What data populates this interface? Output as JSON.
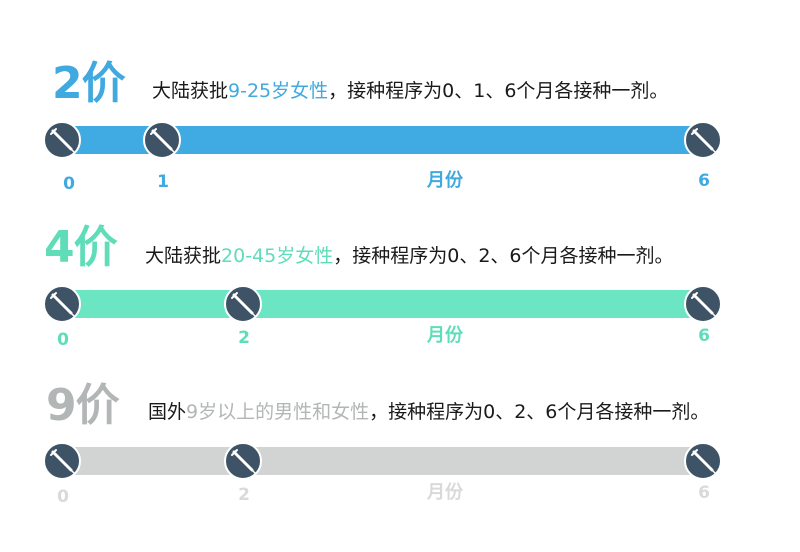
{
  "rows": [
    {
      "valence": "2价",
      "desc_prefix": "大陆获批",
      "desc_highlight": "9-25岁女性",
      "desc_suffix": "，接种程序为0、1、6个月各接种一剂。",
      "color": "#3fa9e0",
      "bar_color": "#40abe2",
      "ticks": [
        "0",
        "1",
        "6"
      ],
      "axis_label": "月份"
    },
    {
      "valence": "4价",
      "desc_prefix": "大陆获批",
      "desc_highlight": "20-45岁女性",
      "desc_suffix": "，接种程序为0、2、6个月各接种一剂。",
      "color": "#5fddb8",
      "bar_color": "#6ce5c3",
      "ticks": [
        "0",
        "2",
        "6"
      ],
      "axis_label": "月份"
    },
    {
      "valence": "9价",
      "desc_prefix": "国外",
      "desc_highlight": "9岁以上的男性和女性",
      "desc_suffix": "，接种程序为0、2、6个月各接种一剂。",
      "color": "#b3b6b6",
      "bar_color": "#d2d4d3",
      "ticks": [
        "0",
        "2",
        "6"
      ],
      "axis_label": "月份"
    }
  ],
  "icons": {
    "dose_marker": "syringe-icon"
  }
}
